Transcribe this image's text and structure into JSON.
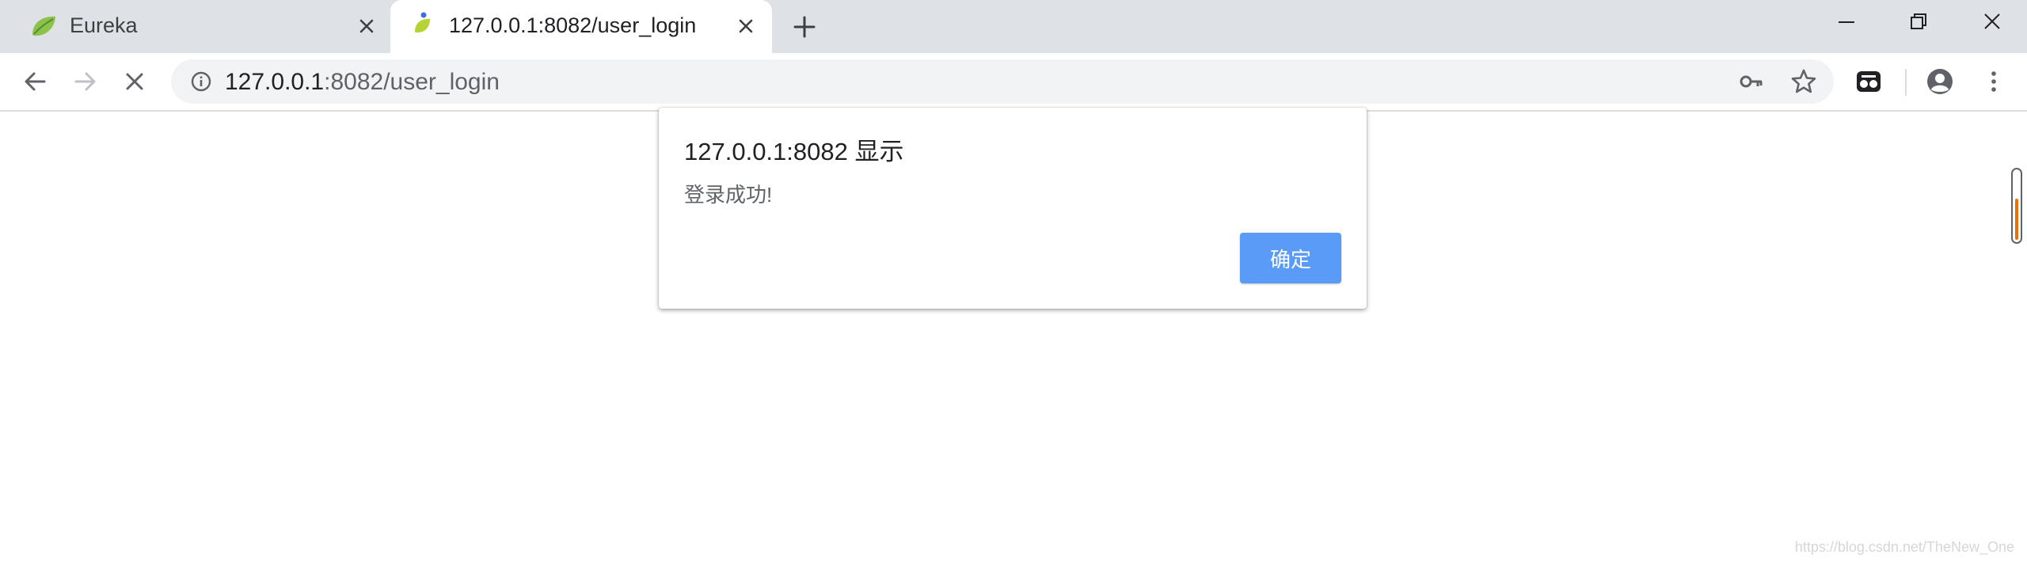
{
  "tabs": [
    {
      "title": "Eureka",
      "favicon": "spring-leaf-icon",
      "active": false
    },
    {
      "title": "127.0.0.1:8082/user_login",
      "favicon": "leaf-drop-icon",
      "active": true
    }
  ],
  "address_bar": {
    "host": "127.0.0.1",
    "rest": ":8082/user_login"
  },
  "dialog": {
    "title": "127.0.0.1:8082 显示",
    "message": "登录成功!",
    "ok_label": "确定"
  },
  "watermark": "https://blog.csdn.net/TheNew_One",
  "colors": {
    "tabstrip_bg": "#dee1e6",
    "omnibox_bg": "#f1f3f4",
    "ok_button": "#5b9bf8",
    "scroll_accent": "#e8710a"
  },
  "icons": [
    "back-arrow-icon",
    "forward-arrow-icon",
    "stop-icon",
    "info-icon",
    "key-icon",
    "star-icon",
    "extension-icon",
    "profile-icon",
    "menu-dots-icon"
  ]
}
